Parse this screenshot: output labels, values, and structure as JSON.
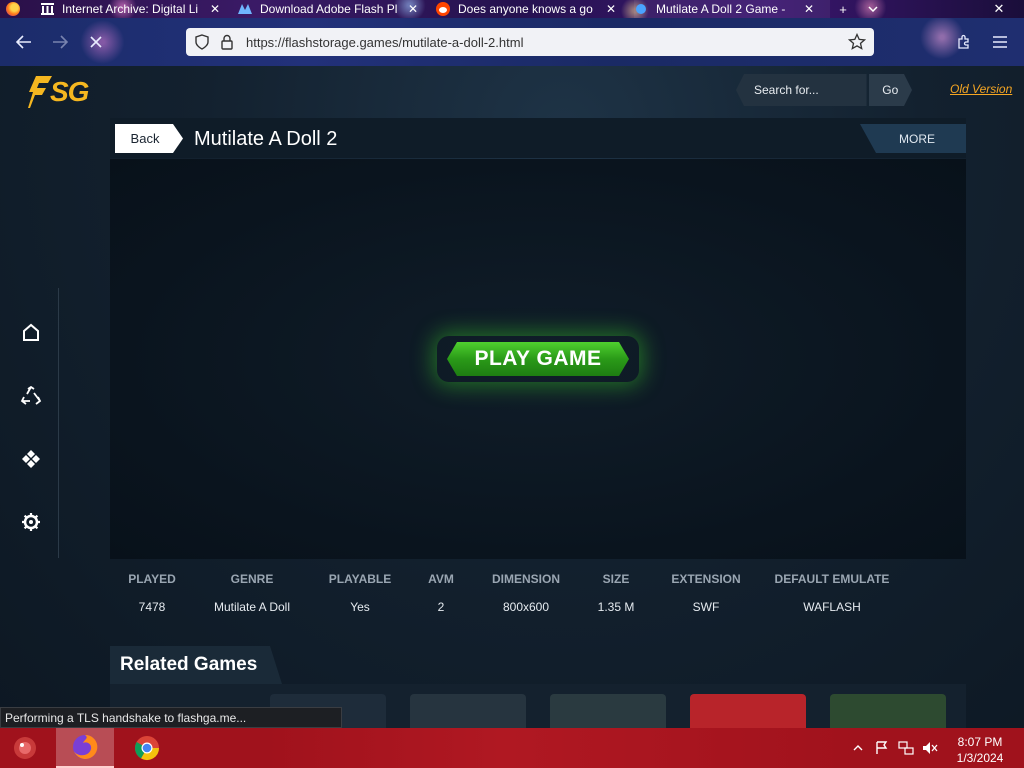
{
  "browser": {
    "tabs": [
      {
        "title": "Internet Archive: Digital Li",
        "favicon": "archive-icon"
      },
      {
        "title": "Download Adobe Flash Pl",
        "favicon": "flash-icon"
      },
      {
        "title": "Does anyone knows a go",
        "favicon": "reddit-icon"
      },
      {
        "title": "Mutilate A Doll 2 Game -",
        "favicon": "game-icon",
        "active": true
      }
    ],
    "new_tab_symbol": "+",
    "url": "https://flashstorage.games/mutilate-a-doll-2.html"
  },
  "site": {
    "logo_text": "SG",
    "search_placeholder": "Search for...",
    "search_button": "Go",
    "old_version_link": "Old Version"
  },
  "game": {
    "back_label": "Back",
    "title": "Mutilate A Doll 2",
    "more_label": "MORE",
    "play_label": "PLAY GAME"
  },
  "info": {
    "columns": [
      {
        "header": "PLAYED",
        "value": "7478"
      },
      {
        "header": "GENRE",
        "value": "Mutilate A Doll"
      },
      {
        "header": "PLAYABLE",
        "value": "Yes"
      },
      {
        "header": "AVM",
        "value": "2"
      },
      {
        "header": "DIMENSION",
        "value": "800x600"
      },
      {
        "header": "SIZE",
        "value": "1.35 M"
      },
      {
        "header": "EXTENSION",
        "value": "SWF"
      },
      {
        "header": "DEFAULT EMULATE",
        "value": "WAFLASH"
      }
    ]
  },
  "related": {
    "title": "Related Games"
  },
  "status_text": "Performing a TLS handshake to flashga.me...",
  "taskbar": {
    "time": "8:07 PM",
    "date": "1/3/2024"
  },
  "colors": {
    "accent_orange": "#f5a623",
    "logo_yellow": "#f5b720",
    "play_green": "#2a9a18",
    "taskbar_red": "#a0121c"
  }
}
